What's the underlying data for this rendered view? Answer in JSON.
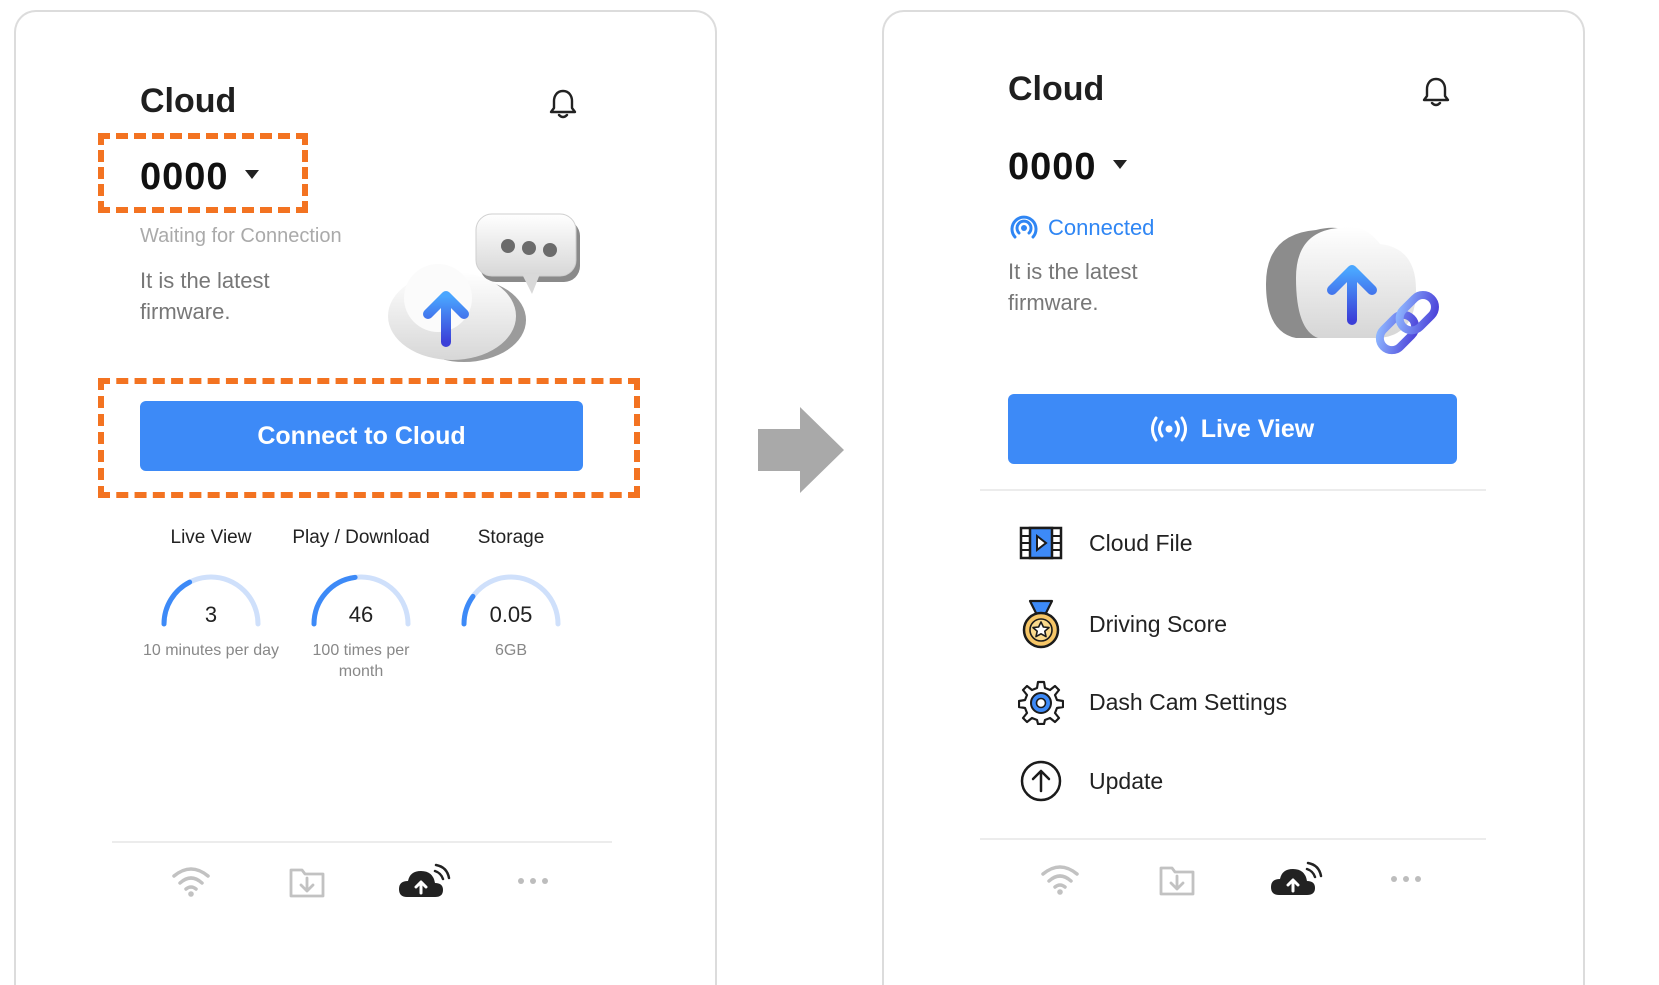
{
  "left": {
    "title": "Cloud",
    "device_name": "0000",
    "status": "Waiting for Connection",
    "firmware": "It is the latest firmware.",
    "connect_button": "Connect to Cloud",
    "stats": [
      {
        "label": "Live View",
        "value": "3",
        "sub": "10 minutes per day",
        "level": 0.35
      },
      {
        "label": "Play / Download",
        "value": "46",
        "sub": "100 times per month",
        "level": 0.46
      },
      {
        "label": "Storage",
        "value": "0.05",
        "sub": "6GB",
        "level": 0.2
      }
    ],
    "nav": [
      "wifi-icon",
      "download-folder-icon",
      "cloud-upload-icon",
      "more-icon"
    ]
  },
  "right": {
    "title": "Cloud",
    "device_name": "0000",
    "status": "Connected",
    "firmware": "It is the latest firmware.",
    "live_button": "Live View",
    "menu": [
      {
        "label": "Cloud File",
        "icon": "film-icon"
      },
      {
        "label": "Driving Score",
        "icon": "medal-icon"
      },
      {
        "label": "Dash Cam Settings",
        "icon": "gear-icon"
      },
      {
        "label": "Update",
        "icon": "upload-arrow-icon"
      }
    ],
    "nav": [
      "wifi-icon",
      "download-folder-icon",
      "cloud-upload-icon",
      "more-icon"
    ]
  },
  "colors": {
    "accent": "#3d8af7",
    "highlight": "#f37321",
    "arrow": "#a9a9a9"
  }
}
